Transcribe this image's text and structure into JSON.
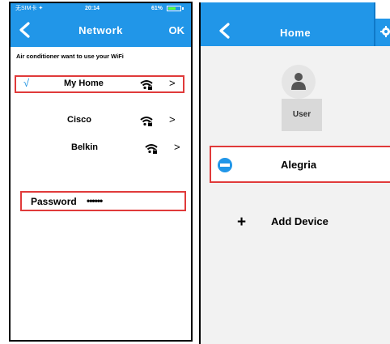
{
  "status_bar": {
    "carrier": "无SIM卡 ✦",
    "time": "20:14",
    "battery": "61%"
  },
  "network_screen": {
    "title": "Network",
    "ok_label": "OK",
    "prompt": "Air conditioner want to use your WiFi",
    "selected_mark": "√",
    "networks": [
      {
        "ssid": "My Home",
        "selected": true
      },
      {
        "ssid": "Cisco",
        "selected": false
      },
      {
        "ssid": "Belkin",
        "selected": false
      }
    ],
    "chevron": ">",
    "password_label": "Password",
    "password_mask": "••••••"
  },
  "home_screen": {
    "title": "Home",
    "user_label": "User",
    "device_name": "Alegria",
    "add_icon": "+",
    "add_label": "Add Device"
  },
  "icons": {
    "back": "chevron-left-icon",
    "wifi": "wifi-lock-icon",
    "gear": "gear-icon",
    "user": "user-icon",
    "device": "minus-circle-icon"
  },
  "colors": {
    "accent": "#2196e8",
    "highlight": "#e03a3a"
  }
}
